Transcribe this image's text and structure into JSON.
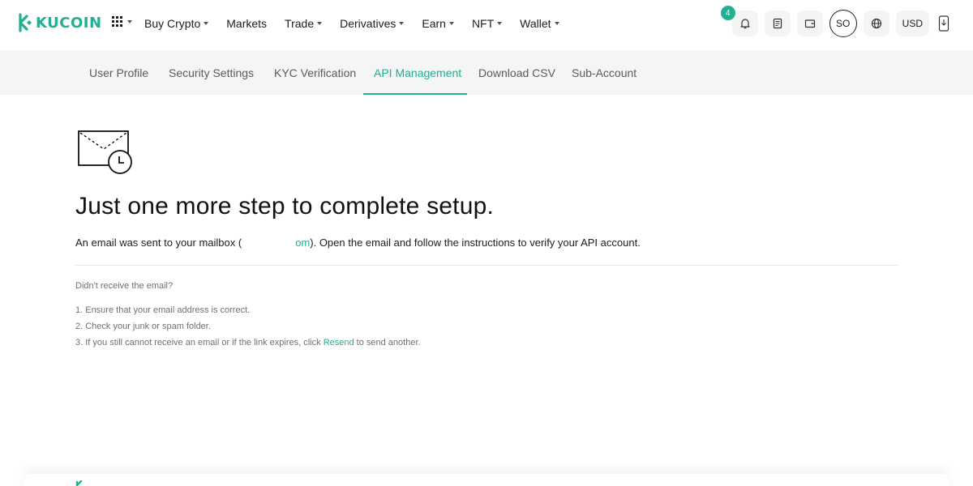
{
  "brand": {
    "name": "KUCOIN",
    "color": "#23af91"
  },
  "nav": {
    "items": [
      {
        "label": "Buy Crypto",
        "dropdown": true
      },
      {
        "label": "Markets",
        "dropdown": false
      },
      {
        "label": "Trade",
        "dropdown": true
      },
      {
        "label": "Derivatives",
        "dropdown": true
      },
      {
        "label": "Earn",
        "dropdown": true
      },
      {
        "label": "NFT",
        "dropdown": true
      },
      {
        "label": "Wallet",
        "dropdown": true
      }
    ]
  },
  "header_right": {
    "notification_count": "4",
    "avatar_initials": "SO",
    "currency": "USD",
    "icons": [
      "bell-icon",
      "orders-icon",
      "wallet-icon",
      "globe-icon",
      "phone-download-icon"
    ]
  },
  "subnav": {
    "tabs": [
      {
        "label": "User Profile"
      },
      {
        "label": "Security Settings"
      },
      {
        "label": "KYC Verification"
      },
      {
        "label": "API Management",
        "active": true
      },
      {
        "label": "Download CSV"
      },
      {
        "label": "Sub-Account"
      }
    ]
  },
  "main": {
    "headline": "Just one more step to complete setup.",
    "message_prefix": "An email was sent to your mailbox (",
    "email_suffix": "om",
    "message_suffix": "). Open the email and follow the instructions to verify your API account.",
    "help_title": "Didn't receive the email?",
    "step1": "1. Ensure that your email address is correct.",
    "step2": "2. Check your junk or spam folder.",
    "step3_prefix": "3. If you still cannot receive an email or if the link expires, click ",
    "resend_label": "Resend",
    "step3_suffix": " to send another."
  }
}
